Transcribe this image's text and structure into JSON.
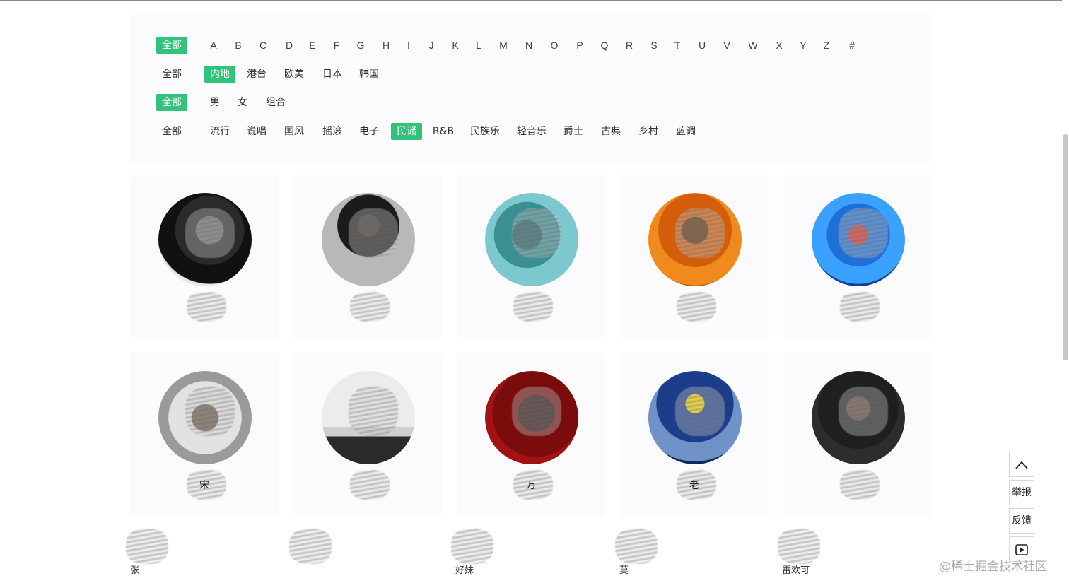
{
  "filters": {
    "letters": [
      "全部",
      "A",
      "B",
      "C",
      "D",
      "E",
      "F",
      "G",
      "H",
      "I",
      "J",
      "K",
      "L",
      "M",
      "N",
      "O",
      "P",
      "Q",
      "R",
      "S",
      "T",
      "U",
      "V",
      "W",
      "X",
      "Y",
      "Z",
      "#"
    ],
    "letters_active": 0,
    "areas": [
      "全部",
      "内地",
      "港台",
      "欧美",
      "日本",
      "韩国"
    ],
    "areas_active": 1,
    "genders": [
      "全部",
      "男",
      "女",
      "组合"
    ],
    "genders_active": 0,
    "genres": [
      "全部",
      "流行",
      "说唱",
      "国风",
      "摇滚",
      "电子",
      "民谣",
      "R&B",
      "民族乐",
      "轻音乐",
      "爵士",
      "古典",
      "乡村",
      "蓝调"
    ],
    "genres_active": 6
  },
  "singers": [
    {
      "name": ""
    },
    {
      "name": ""
    },
    {
      "name": ""
    },
    {
      "name": ""
    },
    {
      "name": ""
    },
    {
      "name": "宋"
    },
    {
      "name": ""
    },
    {
      "name": "万"
    },
    {
      "name": "老"
    },
    {
      "name": ""
    }
  ],
  "bottom_names": [
    "张",
    "",
    "好妹",
    "莫",
    "雷欢可"
  ],
  "side_tools": {
    "top": "",
    "report": "举报",
    "feedback": "反馈",
    "play": ""
  },
  "watermark": "@稀土掘金技术社区",
  "colors": {
    "accent": "#31c27c"
  }
}
